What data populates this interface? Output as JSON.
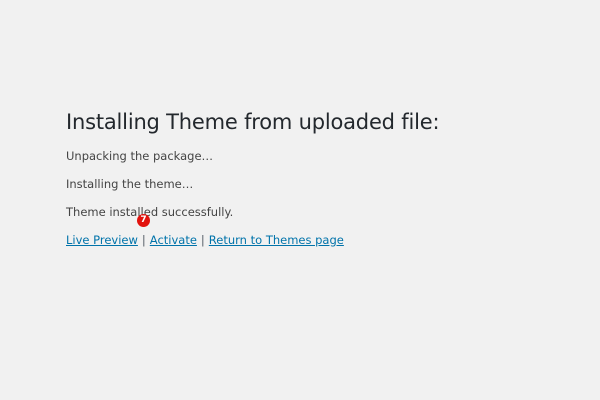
{
  "heading": "Installing Theme from uploaded file:",
  "log": [
    "Unpacking the package…",
    "Installing the theme…",
    "Theme installed successfully."
  ],
  "actions": {
    "live_preview": "Live Preview",
    "activate": "Activate",
    "return": "Return to Themes page",
    "separator": "|"
  },
  "step_badge": "7",
  "colors": {
    "background": "#f1f1f1",
    "link": "#0073aa",
    "badge": "#e2120d"
  }
}
